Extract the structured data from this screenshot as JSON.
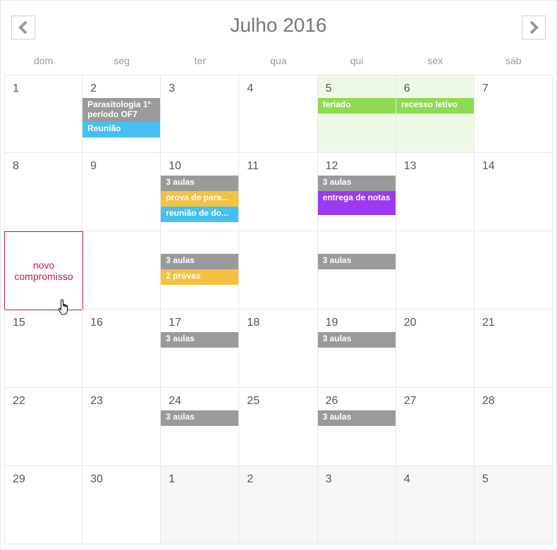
{
  "header": {
    "title": "Julho 2016",
    "prev_icon": "chevron-left-icon",
    "next_icon": "chevron-right-icon"
  },
  "weekdays": [
    "dom",
    "seg",
    "ter",
    "qua",
    "qui",
    "sex",
    "sáb"
  ],
  "colors": {
    "gray": "#9a9a9a",
    "blue": "#45c0f0",
    "green": "#8ddb55",
    "yellow": "#f5c142",
    "purple": "#9b3af0",
    "highlight": "#eef8e6",
    "new_appointment": "#c2185b"
  },
  "weeks": [
    [
      {
        "day": "1"
      },
      {
        "day": "2",
        "events": [
          {
            "label": "Parasitologia 1º período OF7",
            "color": "gray",
            "lines": 2
          },
          {
            "label": "Reunião",
            "color": "blue"
          }
        ]
      },
      {
        "day": "3"
      },
      {
        "day": "4"
      },
      {
        "day": "5",
        "highlight": true,
        "events": [
          {
            "label": "feriado",
            "color": "green"
          }
        ]
      },
      {
        "day": "6",
        "highlight": true,
        "events": [
          {
            "label": "recesso letivo",
            "color": "green"
          }
        ]
      },
      {
        "day": "7"
      }
    ],
    [
      {
        "day": "8"
      },
      {
        "day": "9"
      },
      {
        "day": "10",
        "events": [
          {
            "label": "3 aulas",
            "color": "gray"
          },
          {
            "label": "prova de para...",
            "color": "yellow"
          },
          {
            "label": "reunião de do...",
            "color": "blue"
          }
        ]
      },
      {
        "day": "11"
      },
      {
        "day": "12",
        "events": [
          {
            "label": "3 aulas",
            "color": "gray"
          },
          {
            "label": "entrega de notas",
            "color": "purple",
            "lines": 2
          }
        ]
      },
      {
        "day": "13"
      },
      {
        "day": "14"
      }
    ],
    [
      {
        "day": ""
      },
      {
        "day": ""
      },
      {
        "day": "",
        "events": [
          {
            "label": "3 aulas",
            "color": "gray"
          },
          {
            "label": "2 provas",
            "color": "yellow"
          }
        ]
      },
      {
        "day": ""
      },
      {
        "day": "",
        "events": [
          {
            "label": "3 aulas",
            "color": "gray"
          }
        ]
      },
      {
        "day": ""
      },
      {
        "day": ""
      }
    ],
    [
      {
        "day": "15"
      },
      {
        "day": "16"
      },
      {
        "day": "17",
        "events": [
          {
            "label": "3 aulas",
            "color": "gray"
          }
        ]
      },
      {
        "day": "18"
      },
      {
        "day": "19",
        "events": [
          {
            "label": "3 aulas",
            "color": "gray"
          }
        ]
      },
      {
        "day": "20"
      },
      {
        "day": "21"
      }
    ],
    [
      {
        "day": "22"
      },
      {
        "day": "23"
      },
      {
        "day": "24",
        "events": [
          {
            "label": "3 aulas",
            "color": "gray"
          }
        ]
      },
      {
        "day": "25"
      },
      {
        "day": "26",
        "events": [
          {
            "label": "3 aulas",
            "color": "gray"
          }
        ]
      },
      {
        "day": "27"
      },
      {
        "day": "28"
      }
    ],
    [
      {
        "day": "29"
      },
      {
        "day": "30"
      },
      {
        "day": "1",
        "other_month": true
      },
      {
        "day": "2",
        "other_month": true
      },
      {
        "day": "3",
        "other_month": true
      },
      {
        "day": "4",
        "other_month": true
      },
      {
        "day": "5",
        "other_month": true
      }
    ]
  ],
  "new_appointment": {
    "label": "novo compromisso"
  }
}
